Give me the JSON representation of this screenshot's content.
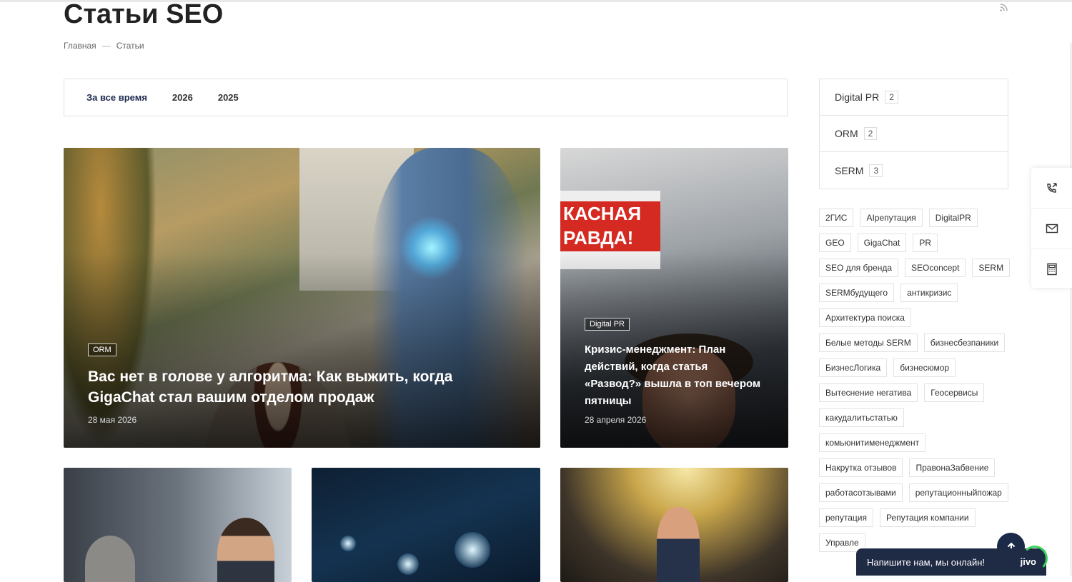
{
  "page": {
    "title": "Статьи SEO",
    "breadcrumb": {
      "home": "Главная",
      "separator": "—",
      "current": "Статьи"
    }
  },
  "filters": {
    "items": [
      {
        "label": "За все время",
        "active": true
      },
      {
        "label": "2026",
        "active": false
      },
      {
        "label": "2025",
        "active": false
      }
    ]
  },
  "articles": [
    {
      "tag": "ORM",
      "title": "Вас нет в голове у алгоритма: Как выжить, когда GigaChat стал вашим отделом продаж",
      "date": "28 мая 2026"
    },
    {
      "tag": "Digital PR",
      "title": "Кризис-менеджмент: План действий, когда статья «Развод?» вышла в топ вечером пятницы",
      "date": "28 апреля 2026",
      "newspaper_text": "КАСНАЯ РАВДА!"
    }
  ],
  "categories": [
    {
      "name": "Digital PR",
      "count": "2"
    },
    {
      "name": "ORM",
      "count": "2"
    },
    {
      "name": "SERM",
      "count": "3"
    }
  ],
  "tags": [
    "2ГИС",
    "AIрепутация",
    "DigitalPR",
    "GEO",
    "GigaChat",
    "PR",
    "SEO для бренда",
    "SEOconcept",
    "SERM",
    "SERMбудущего",
    "антикризис",
    "Архитектура поиска",
    "Белые методы SERM",
    "бизнесбезпаники",
    "БизнесЛогика",
    "бизнесюмор",
    "Вытеснение негатива",
    "Геосервисы",
    "какудалитьстатью",
    "комьюнитименеджмент",
    "Накрутка отзывов",
    "ПравонаЗабвение",
    "работасотзывами",
    "репутационныйпожар",
    "репутация",
    "Репутация компании",
    "Управле"
  ],
  "side_panel": {
    "icons": [
      "phone-callback-icon",
      "mail-icon",
      "calculator-icon"
    ]
  },
  "chat": {
    "text": "Напишите нам, мы онлайн!",
    "brand": "jivo"
  },
  "colors": {
    "accent": "#1c2a4a",
    "chat_ring": "#3bd15a"
  }
}
